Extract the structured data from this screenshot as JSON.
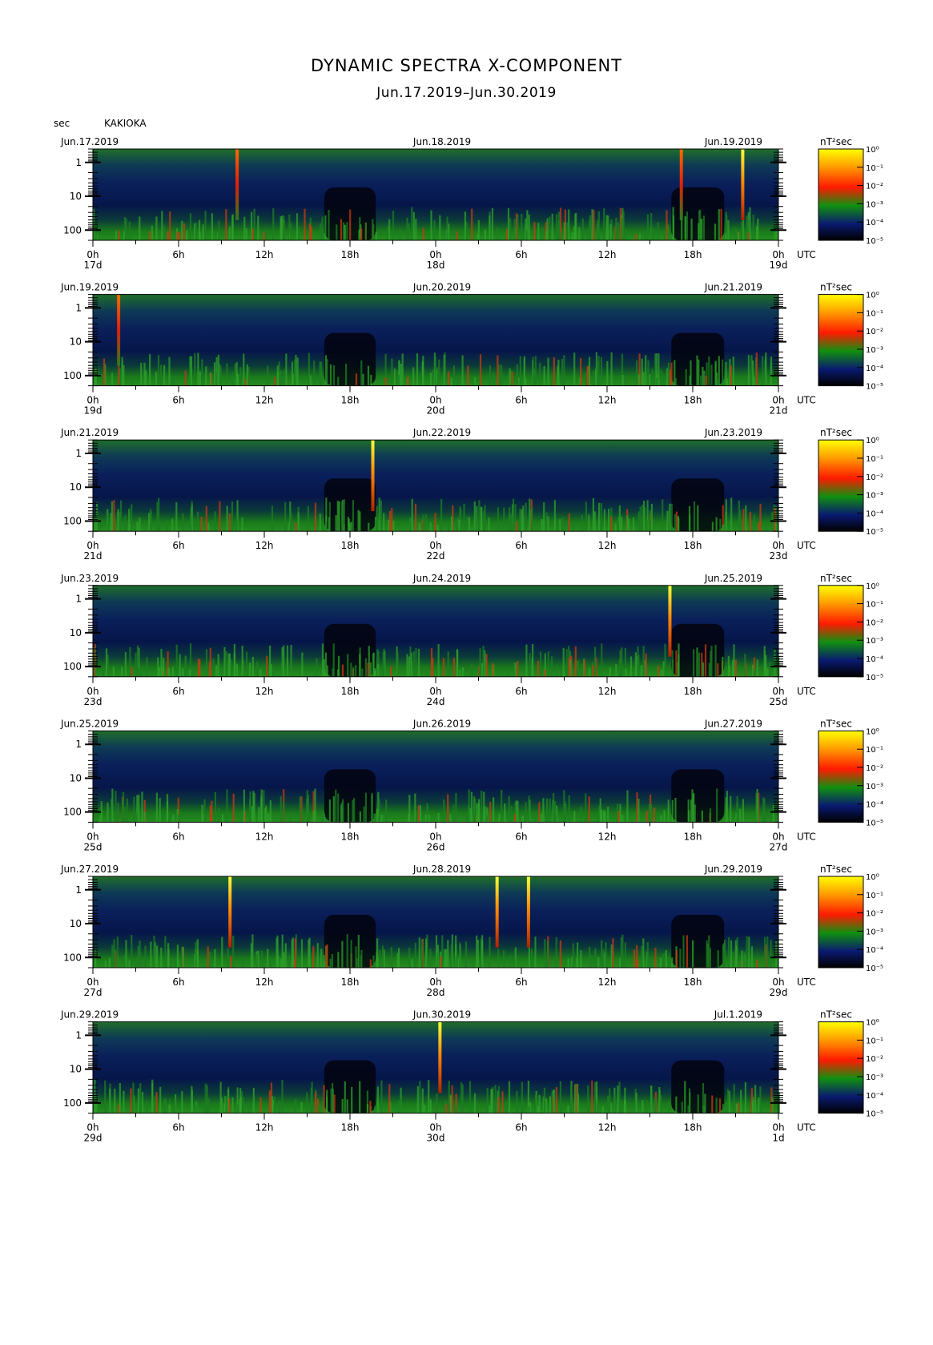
{
  "header": {
    "title": "DYNAMIC SPECTRA X-COMPONENT",
    "subtitle": "Jun.17.2019–Jun.30.2019",
    "y_unit": "sec",
    "station": "KAKIOKA"
  },
  "chart_data": {
    "type": "heatmap",
    "x_unit": "UTC",
    "x_ticks": [
      "0h",
      "6h",
      "12h",
      "18h",
      "0h",
      "6h",
      "12h",
      "18h",
      "0h"
    ],
    "y_ticks": [
      "1",
      "10",
      "100"
    ],
    "colorbar": {
      "unit": "nT²sec",
      "ticks": [
        "10⁰",
        "10⁻¹",
        "10⁻²",
        "10⁻³",
        "10⁻⁴",
        "10⁻⁵"
      ],
      "colors": [
        "#ffff00",
        "#ff8c00",
        "#ff1a00",
        "#0f8a0f",
        "#0a1a70",
        "#000000"
      ]
    },
    "panels": [
      {
        "start_label": "Jun.17.2019",
        "mid_label": "Jun.18.2019",
        "end_label": "Jun.19.2019",
        "day_labels": [
          "17d",
          "18d",
          "19d"
        ],
        "spikes": [
          {
            "hour": 10.1,
            "level": "red"
          },
          {
            "hour": 41.2,
            "level": "red"
          },
          {
            "hour": 45.5,
            "level": "yellow"
          }
        ]
      },
      {
        "start_label": "Jun.19.2019",
        "mid_label": "Jun.20.2019",
        "end_label": "Jun.21.2019",
        "day_labels": [
          "19d",
          "20d",
          "21d"
        ],
        "spikes": [
          {
            "hour": 1.8,
            "level": "red"
          }
        ]
      },
      {
        "start_label": "Jun.21.2019",
        "mid_label": "Jun.22.2019",
        "end_label": "Jun.23.2019",
        "day_labels": [
          "21d",
          "22d",
          "23d"
        ],
        "spikes": [
          {
            "hour": 19.6,
            "level": "yellow"
          }
        ]
      },
      {
        "start_label": "Jun.23.2019",
        "mid_label": "Jun.24.2019",
        "end_label": "Jun.25.2019",
        "day_labels": [
          "23d",
          "24d",
          "25d"
        ],
        "spikes": [
          {
            "hour": 40.4,
            "level": "yellow"
          }
        ]
      },
      {
        "start_label": "Jun.25.2019",
        "mid_label": "Jun.26.2019",
        "end_label": "Jun.27.2019",
        "day_labels": [
          "25d",
          "26d",
          "27d"
        ],
        "spikes": []
      },
      {
        "start_label": "Jun.27.2019",
        "mid_label": "Jun.28.2019",
        "end_label": "Jun.29.2019",
        "day_labels": [
          "27d",
          "28d",
          "29d"
        ],
        "spikes": [
          {
            "hour": 9.6,
            "level": "yellow"
          },
          {
            "hour": 28.3,
            "level": "yellow"
          },
          {
            "hour": 30.5,
            "level": "yellow"
          }
        ]
      },
      {
        "start_label": "Jun.29.2019",
        "mid_label": "Jun.30.2019",
        "end_label": "Jul.1.2019",
        "day_labels": [
          "29d",
          "30d",
          "1d"
        ],
        "spikes": [
          {
            "hour": 24.3,
            "level": "yellow"
          }
        ]
      }
    ]
  }
}
